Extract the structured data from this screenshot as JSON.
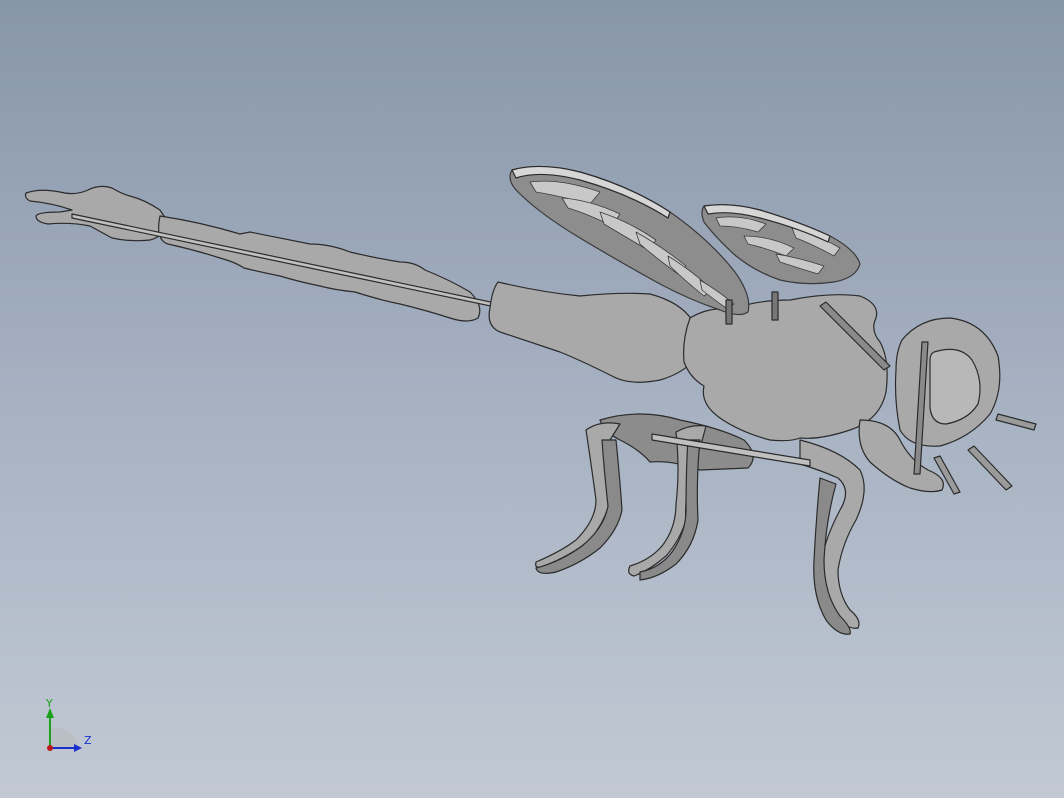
{
  "viewport": {
    "background_top": "#8896aa",
    "background_bottom": "#c2c9d4",
    "model": {
      "subject": "dragonfly",
      "body_fill": "#a9a9a9",
      "body_stroke": "#2b2b2b",
      "wing_fill": "#8d8d8d",
      "wing_edge": "#555555",
      "highlight": "#cfcfcf"
    }
  },
  "triad": {
    "y_label": "Y",
    "z_label": "Z",
    "y_color": "#1aa01a",
    "z_color": "#1a2fd0",
    "x_color": "#c01818",
    "icon": "coordinate-triad-icon"
  }
}
